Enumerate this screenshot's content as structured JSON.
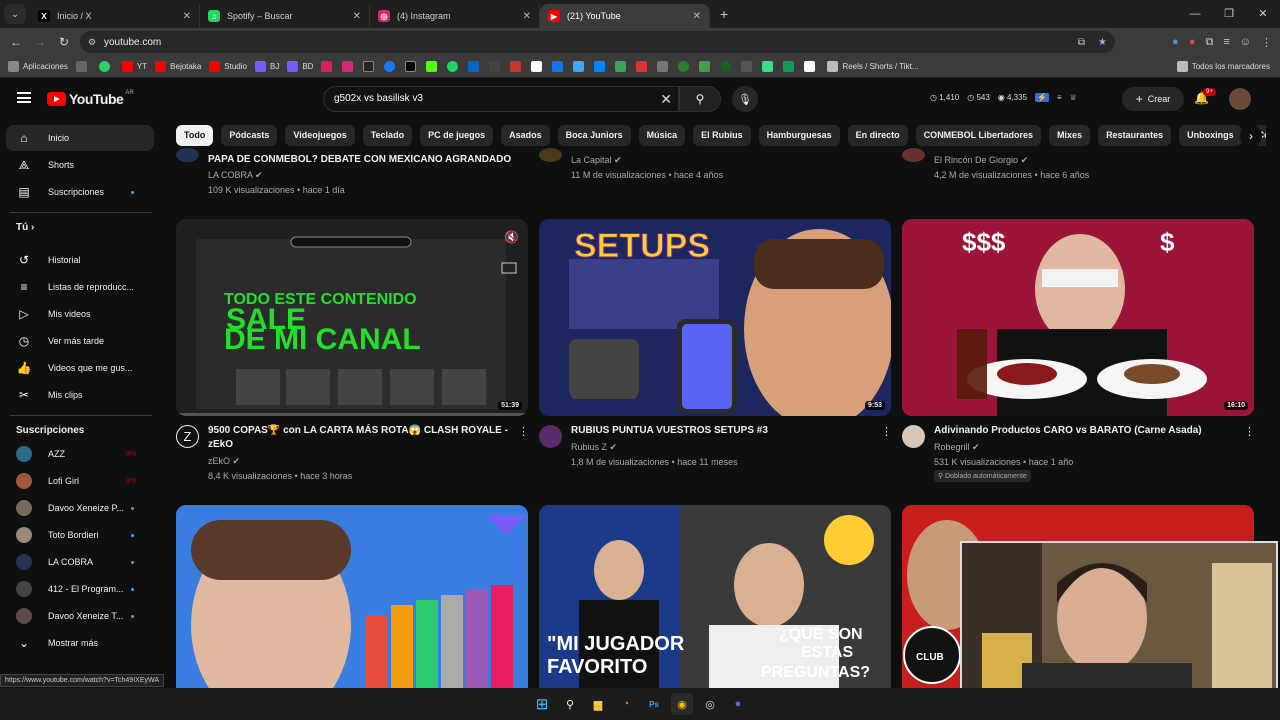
{
  "browser": {
    "tabs": [
      {
        "label": "Inicio / X",
        "icon": "x-icon",
        "fav": "X",
        "color": "#000000",
        "active": false
      },
      {
        "label": "Spotify – Buscar",
        "icon": "spotify-icon",
        "fav": "♫",
        "color": "#1ed760",
        "active": false
      },
      {
        "label": "(4) Instagram",
        "icon": "instagram-icon",
        "fav": "◎",
        "color": "#d62976",
        "active": false
      },
      {
        "label": "(21) YouTube",
        "icon": "youtube-icon",
        "fav": "▶",
        "color": "#ff0000",
        "active": true
      }
    ],
    "url": "youtube.com",
    "bookmarks": {
      "apps": "Aplicaciones",
      "yt": "YT",
      "bejotaka": "Bejotaka",
      "studio": "Studio",
      "bj": "BJ",
      "bd": "BD",
      "reels": "Reels / Shorts / Tikt...",
      "all": "Todos los marcadores"
    },
    "status_url": "https://www.youtube.com/watch?v=Tch49IXEyWA"
  },
  "header": {
    "logo": "YouTube",
    "region": "AR",
    "search_value": "g502x vs basilisk v3",
    "stats": [
      "1,410",
      "543",
      "4,335"
    ],
    "create_label": "Crear",
    "notif_count": "9+"
  },
  "sidebar": {
    "main": [
      {
        "label": "Inicio",
        "icon": "home-icon",
        "glyph": "⌂"
      },
      {
        "label": "Shorts",
        "icon": "shorts-icon",
        "glyph": "⟁"
      },
      {
        "label": "Suscripciones",
        "icon": "subscriptions-icon",
        "glyph": "▤"
      }
    ],
    "you_heading": "Tú",
    "you": [
      {
        "label": "Historial",
        "icon": "history-icon",
        "glyph": "↺"
      },
      {
        "label": "Listas de reproducc...",
        "icon": "playlist-icon",
        "glyph": "≡"
      },
      {
        "label": "Mis videos",
        "icon": "my-videos-icon",
        "glyph": "▷"
      },
      {
        "label": "Ver más tarde",
        "icon": "watch-later-icon",
        "glyph": "◷"
      },
      {
        "label": "Videos que me gus...",
        "icon": "like-icon",
        "glyph": "👍"
      },
      {
        "label": "Mis clips",
        "icon": "clips-icon",
        "glyph": "✂"
      }
    ],
    "subs_heading": "Suscripciones",
    "subs": [
      {
        "label": "AZZ",
        "color": "#2d6b8a",
        "live": true
      },
      {
        "label": "Lofi Girl",
        "color": "#a05a3a",
        "live": true
      },
      {
        "label": "Davoo Xeneize P...",
        "color": "#7a6a5a",
        "live": false
      },
      {
        "label": "Toto Bordieri",
        "color": "#9a8a7a",
        "live": false
      },
      {
        "label": "LA COBRA",
        "color": "#223355",
        "live": false
      },
      {
        "label": "412 - El Program...",
        "color": "#444444",
        "live": false
      },
      {
        "label": "Davoo Xeneize T...",
        "color": "#5a4a4a",
        "live": false
      }
    ],
    "show_more": "Mostrar más"
  },
  "chips": [
    "Todo",
    "Pódcasts",
    "Videojuegos",
    "Teclado",
    "PC de juegos",
    "Asados",
    "Boca Juniors",
    "Música",
    "El Rubius",
    "Hamburguesas",
    "En directo",
    "CONMEBOL Libertadores",
    "Mixes",
    "Restaurantes",
    "Unboxings",
    "Co"
  ],
  "top_row": [
    {
      "title": "PAPA DE CONMEBOL? DEBATE CON MEXICANO AGRANDADO",
      "channel": "LA COBRA",
      "verified": true,
      "meta": "109 K visualizaciones • hace 1 día"
    },
    {
      "title": "",
      "channel": "La Capital",
      "verified": true,
      "meta": "11 M de visualizaciones • hace 4 años"
    },
    {
      "title": "",
      "channel": "El Rincón De Giorgio",
      "verified": true,
      "meta": "4,2 M de visualizaciones • hace 6 años"
    }
  ],
  "videos": [
    {
      "title1": "9500 COPAS🏆 con LA CARTA MÁS ROTA😱 CLASH ROYALE -",
      "title2": "zEkO",
      "channel": "zEkO",
      "meta": "8,4 K visualizaciones • hace 3 horas",
      "duration": "51:39",
      "thumb_text1": "TODO ESTE CONTENIDO",
      "thumb_text2": "SALE",
      "thumb_text3": "DE MI CANAL"
    },
    {
      "title1": "RUBIUS PUNTUA VUESTROS SETUPS #3",
      "title2": "",
      "channel": "Rubius Z",
      "meta": "1,8 M de visualizaciones • hace 11 meses",
      "duration": "9:53",
      "thumb_text1": "SETUPS"
    },
    {
      "title1": "Adivinando Productos CARO vs BARATO (Carne Asada)",
      "title2": "",
      "channel": "Robegrill",
      "meta": "531 K visualizaciones • hace 1 año",
      "duration": "16:10",
      "badge": "Doblado automáticamente",
      "thumb_text1": "$$$",
      "thumb_text2": "$"
    }
  ],
  "bottom_row": [
    {
      "thumb_text": ""
    },
    {
      "thumb_text1": "\"MI JUGADOR",
      "thumb_text2": "FAVORITO",
      "thumb_text3": "¿QUÉ SON",
      "thumb_text4": "ESTAS",
      "thumb_text5": "PREGUNTAS?"
    },
    {
      "thumb_text": "CLUB"
    }
  ]
}
